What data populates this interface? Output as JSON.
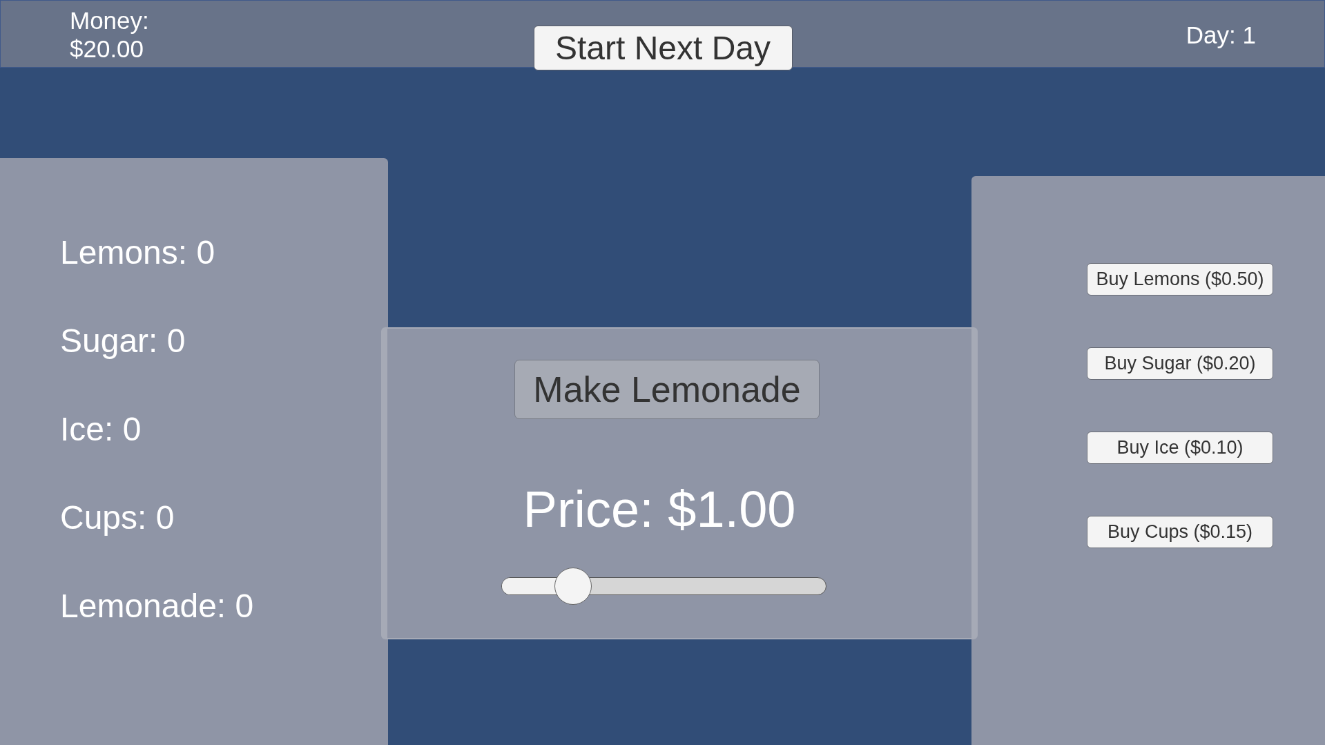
{
  "top_bar": {
    "money_label": "Money:",
    "money_value": "$20.00",
    "start_button": "Start Next Day",
    "day": "Day: 1"
  },
  "inventory": [
    "Lemons: 0",
    "Sugar: 0",
    "Ice: 0",
    "Cups: 0",
    "Lemonade: 0"
  ],
  "production_panel": {
    "make_button": "Make Lemonade",
    "price": "Price: $1.00",
    "price_slider": {
      "level": 0.22
    }
  },
  "shop_buttons": [
    "Buy Lemons ($0.50)",
    "Buy Sugar ($0.20)",
    "Buy Ice ($0.10)",
    "Buy Cups ($0.15)"
  ]
}
